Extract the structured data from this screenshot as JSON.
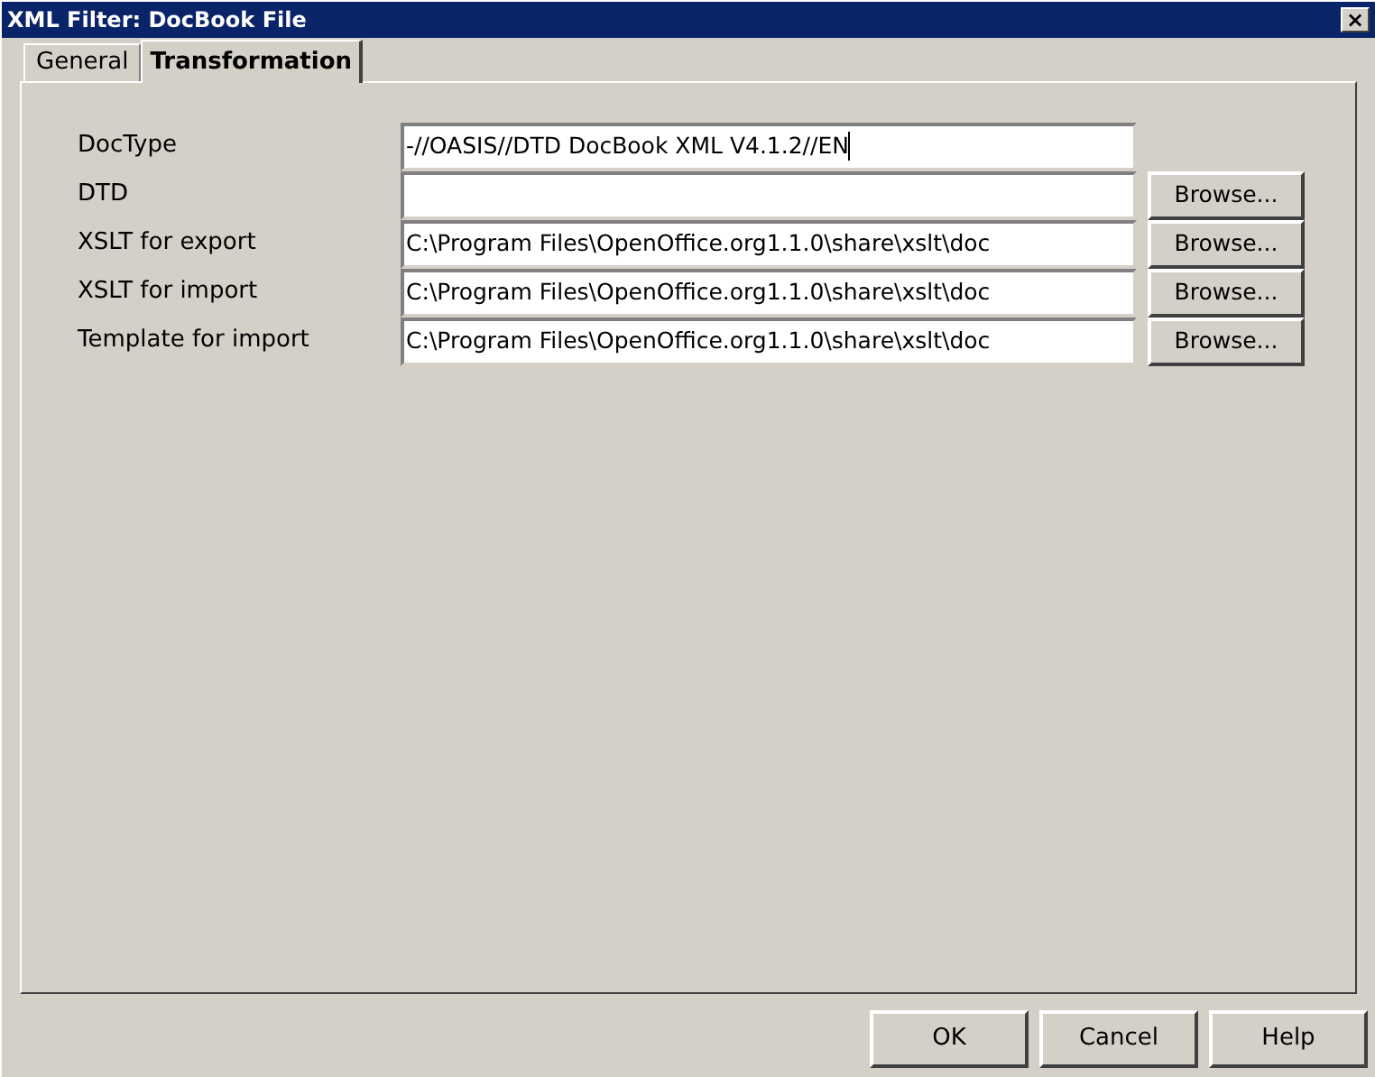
{
  "window": {
    "title": "XML Filter: DocBook File",
    "close": "×"
  },
  "tabs": [
    {
      "label": "General",
      "selected": false
    },
    {
      "label": "Transformation",
      "selected": true
    }
  ],
  "fields": [
    {
      "label": "DocType",
      "value": "-//OASIS//DTD DocBook XML V4.1.2//EN",
      "focused": true
    },
    {
      "label": "DTD",
      "button": "Browse...",
      "focused": false
    },
    {
      "label": "XSLT for export",
      "value": "C:\\Program Files\\OpenOffice.org1.1.0\\share\\xslt\\doc",
      "button": "Browse...",
      "focused": false
    },
    {
      "label": "XSLT for import",
      "value": "C:\\Program Files\\OpenOffice.org1.1.0\\share\\xslt\\doc",
      "button": "Browse...",
      "focused": false
    },
    {
      "label": "Template for import",
      "value": "C:\\Program Files\\OpenOffice.org1.1.0\\share\\xslt\\doc",
      "button": "Browse...",
      "focused": false
    }
  ],
  "buttons": [
    "OK",
    "Cancel",
    "Help"
  ]
}
